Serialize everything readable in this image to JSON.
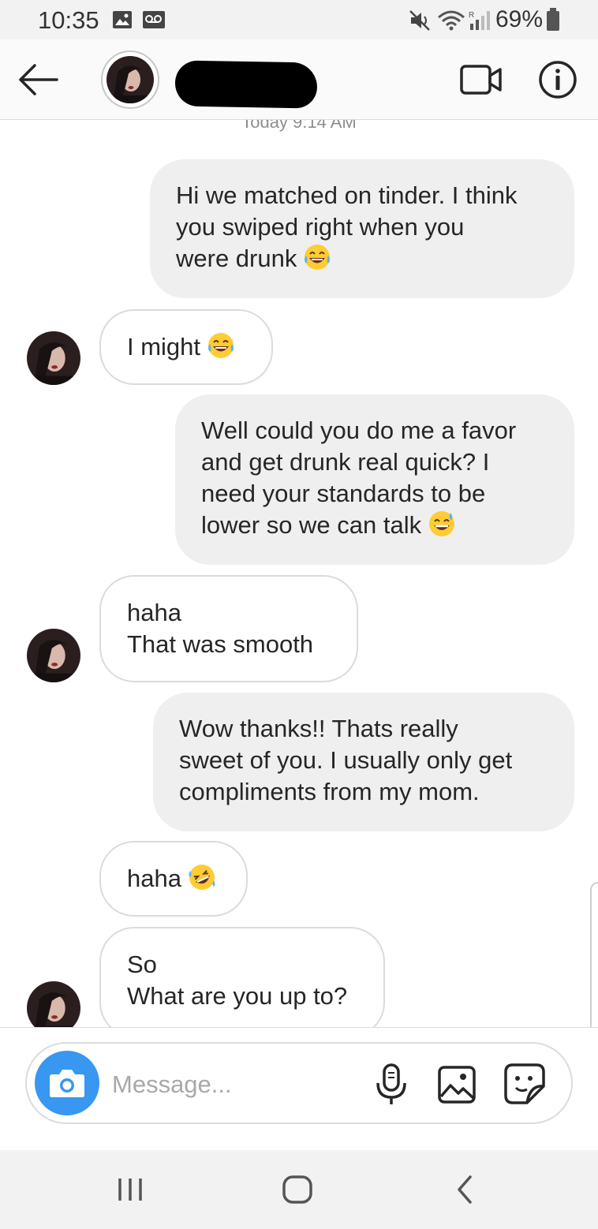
{
  "status_bar": {
    "time": "10:35",
    "battery": "69%",
    "icons": [
      "image-notification-icon",
      "voicemail-icon",
      "mute-icon",
      "wifi-icon",
      "signal-icon",
      "battery-icon"
    ]
  },
  "header": {
    "back_icon": "arrow-left-icon",
    "contact_name_redacted": true,
    "actions": [
      "video-call-icon",
      "info-icon"
    ]
  },
  "chat": {
    "timestamp": "Today 9:14 AM",
    "messages": [
      {
        "direction": "out",
        "lines": [
          "Hi we matched on tinder. I think",
          "you swiped right when you",
          "were drunk"
        ],
        "emoji": "tears-of-joy"
      },
      {
        "direction": "in",
        "lines": [
          "I might"
        ],
        "emoji": "tears-of-joy"
      },
      {
        "direction": "out",
        "lines": [
          "Well could you do me a favor",
          "and get drunk real quick? I",
          "need your standards to be",
          "lower so we can talk"
        ],
        "emoji": "grinning-sweat"
      },
      {
        "direction": "in",
        "lines": [
          "haha",
          "That was smooth"
        ]
      },
      {
        "direction": "out",
        "lines": [
          "Wow thanks!! Thats really",
          "sweet of you. I usually only get",
          "compliments from my mom."
        ]
      },
      {
        "direction": "in",
        "lines": [
          "haha"
        ],
        "emoji": "rolling-laughing"
      },
      {
        "direction": "in",
        "lines": [
          "So",
          "What are you up to?"
        ]
      }
    ]
  },
  "composer": {
    "placeholder": "Message...",
    "icons": [
      "camera-icon",
      "microphone-icon",
      "gallery-icon",
      "sticker-icon"
    ],
    "accent_color": "#3897f0"
  },
  "nav_bar": {
    "buttons": [
      "recents-icon",
      "home-icon",
      "back-icon"
    ]
  }
}
